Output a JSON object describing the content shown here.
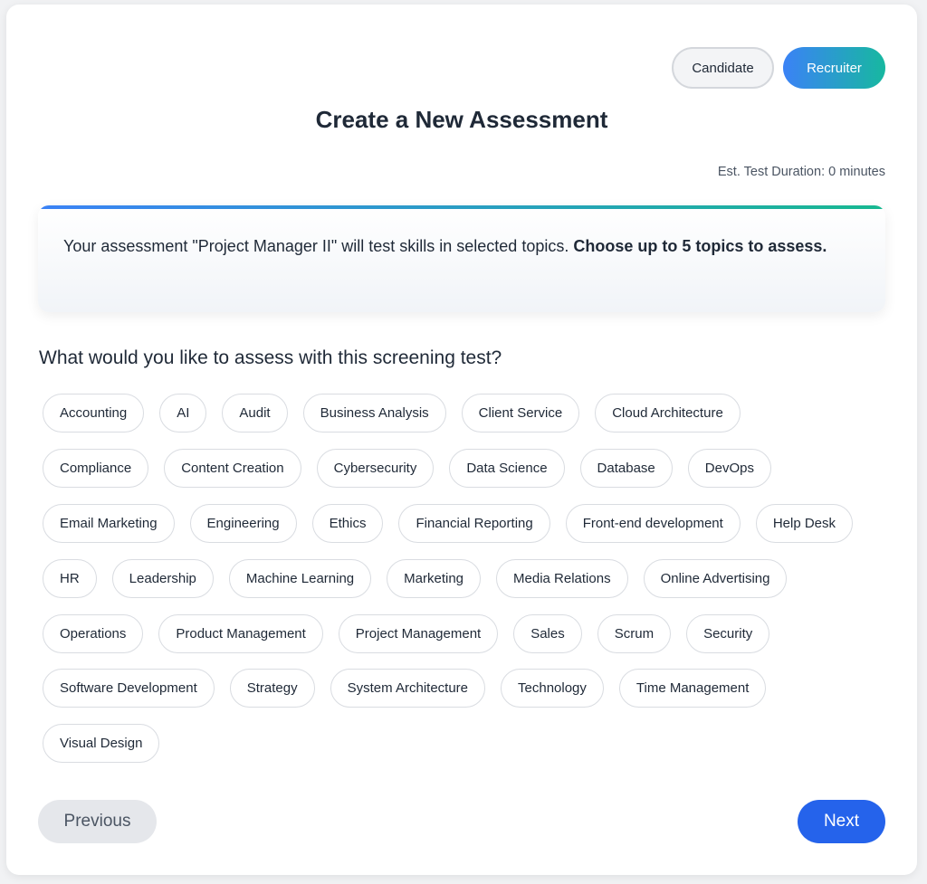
{
  "roles": {
    "candidate_label": "Candidate",
    "recruiter_label": "Recruiter",
    "active": "Recruiter"
  },
  "page_title": "Create a New Assessment",
  "duration_text": "Est. Test Duration: 0 minutes",
  "info": {
    "text_prefix": "Your assessment \"Project Manager II\" will test skills in selected topics. ",
    "text_bold": "Choose up to 5 topics to assess."
  },
  "question": "What would you like to assess with this screening test?",
  "topics": {
    "row1": [
      "Accounting",
      "AI",
      "Audit",
      "Business Analysis",
      "Client Service",
      "Cloud Architecture"
    ],
    "row2": [
      "Compliance",
      "Content Creation",
      "Cybersecurity",
      "Data Science",
      "Database",
      "DevOps"
    ],
    "row3": [
      "Email Marketing",
      "Engineering",
      "Ethics",
      "Financial Reporting",
      "Front-end development",
      "Help Desk"
    ],
    "row4": [
      "HR",
      "Leadership",
      "Machine Learning",
      "Marketing",
      "Media Relations",
      "Online Advertising"
    ],
    "row5": [
      "Operations",
      "Product Management",
      "Project Management",
      "Sales",
      "Scrum",
      "Security"
    ],
    "row6": [
      "Software Development",
      "Strategy",
      "System Architecture",
      "Technology",
      "Time Management"
    ],
    "row7": [
      "Visual Design"
    ]
  },
  "nav": {
    "previous_label": "Previous",
    "next_label": "Next"
  },
  "colors": {
    "accent_blue": "#2563eb",
    "gradient_start": "#3b82f6",
    "gradient_end": "#17b8a0"
  }
}
